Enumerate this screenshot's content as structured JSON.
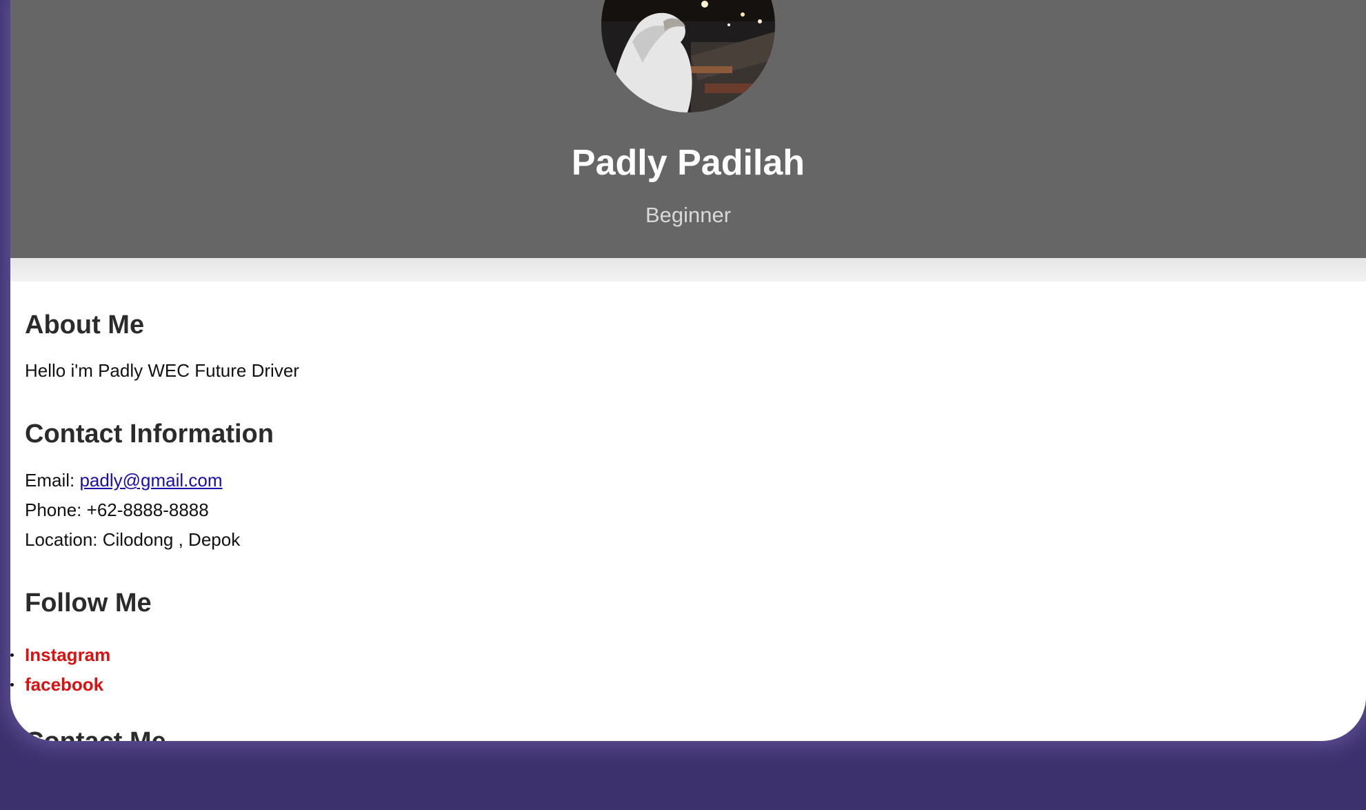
{
  "profile": {
    "name": "Padly Padilah",
    "role": "Beginner"
  },
  "about": {
    "title": "About Me",
    "text": "Hello i'm Padly WEC Future Driver"
  },
  "contact": {
    "title": "Contact Information",
    "email_label": "Email: ",
    "email": "padly@gmail.com",
    "phone": "Phone: +62-8888-8888",
    "location": "Location: Cilodong , Depok"
  },
  "follow": {
    "title": "Follow Me",
    "links": [
      "Instagram",
      "facebook"
    ]
  },
  "next_section": {
    "title": "Contact Me"
  },
  "colors": {
    "page_background": "#3c316d",
    "header_background": "#666666",
    "link_red": "#dd1010",
    "email_link": "#1a0dab"
  }
}
